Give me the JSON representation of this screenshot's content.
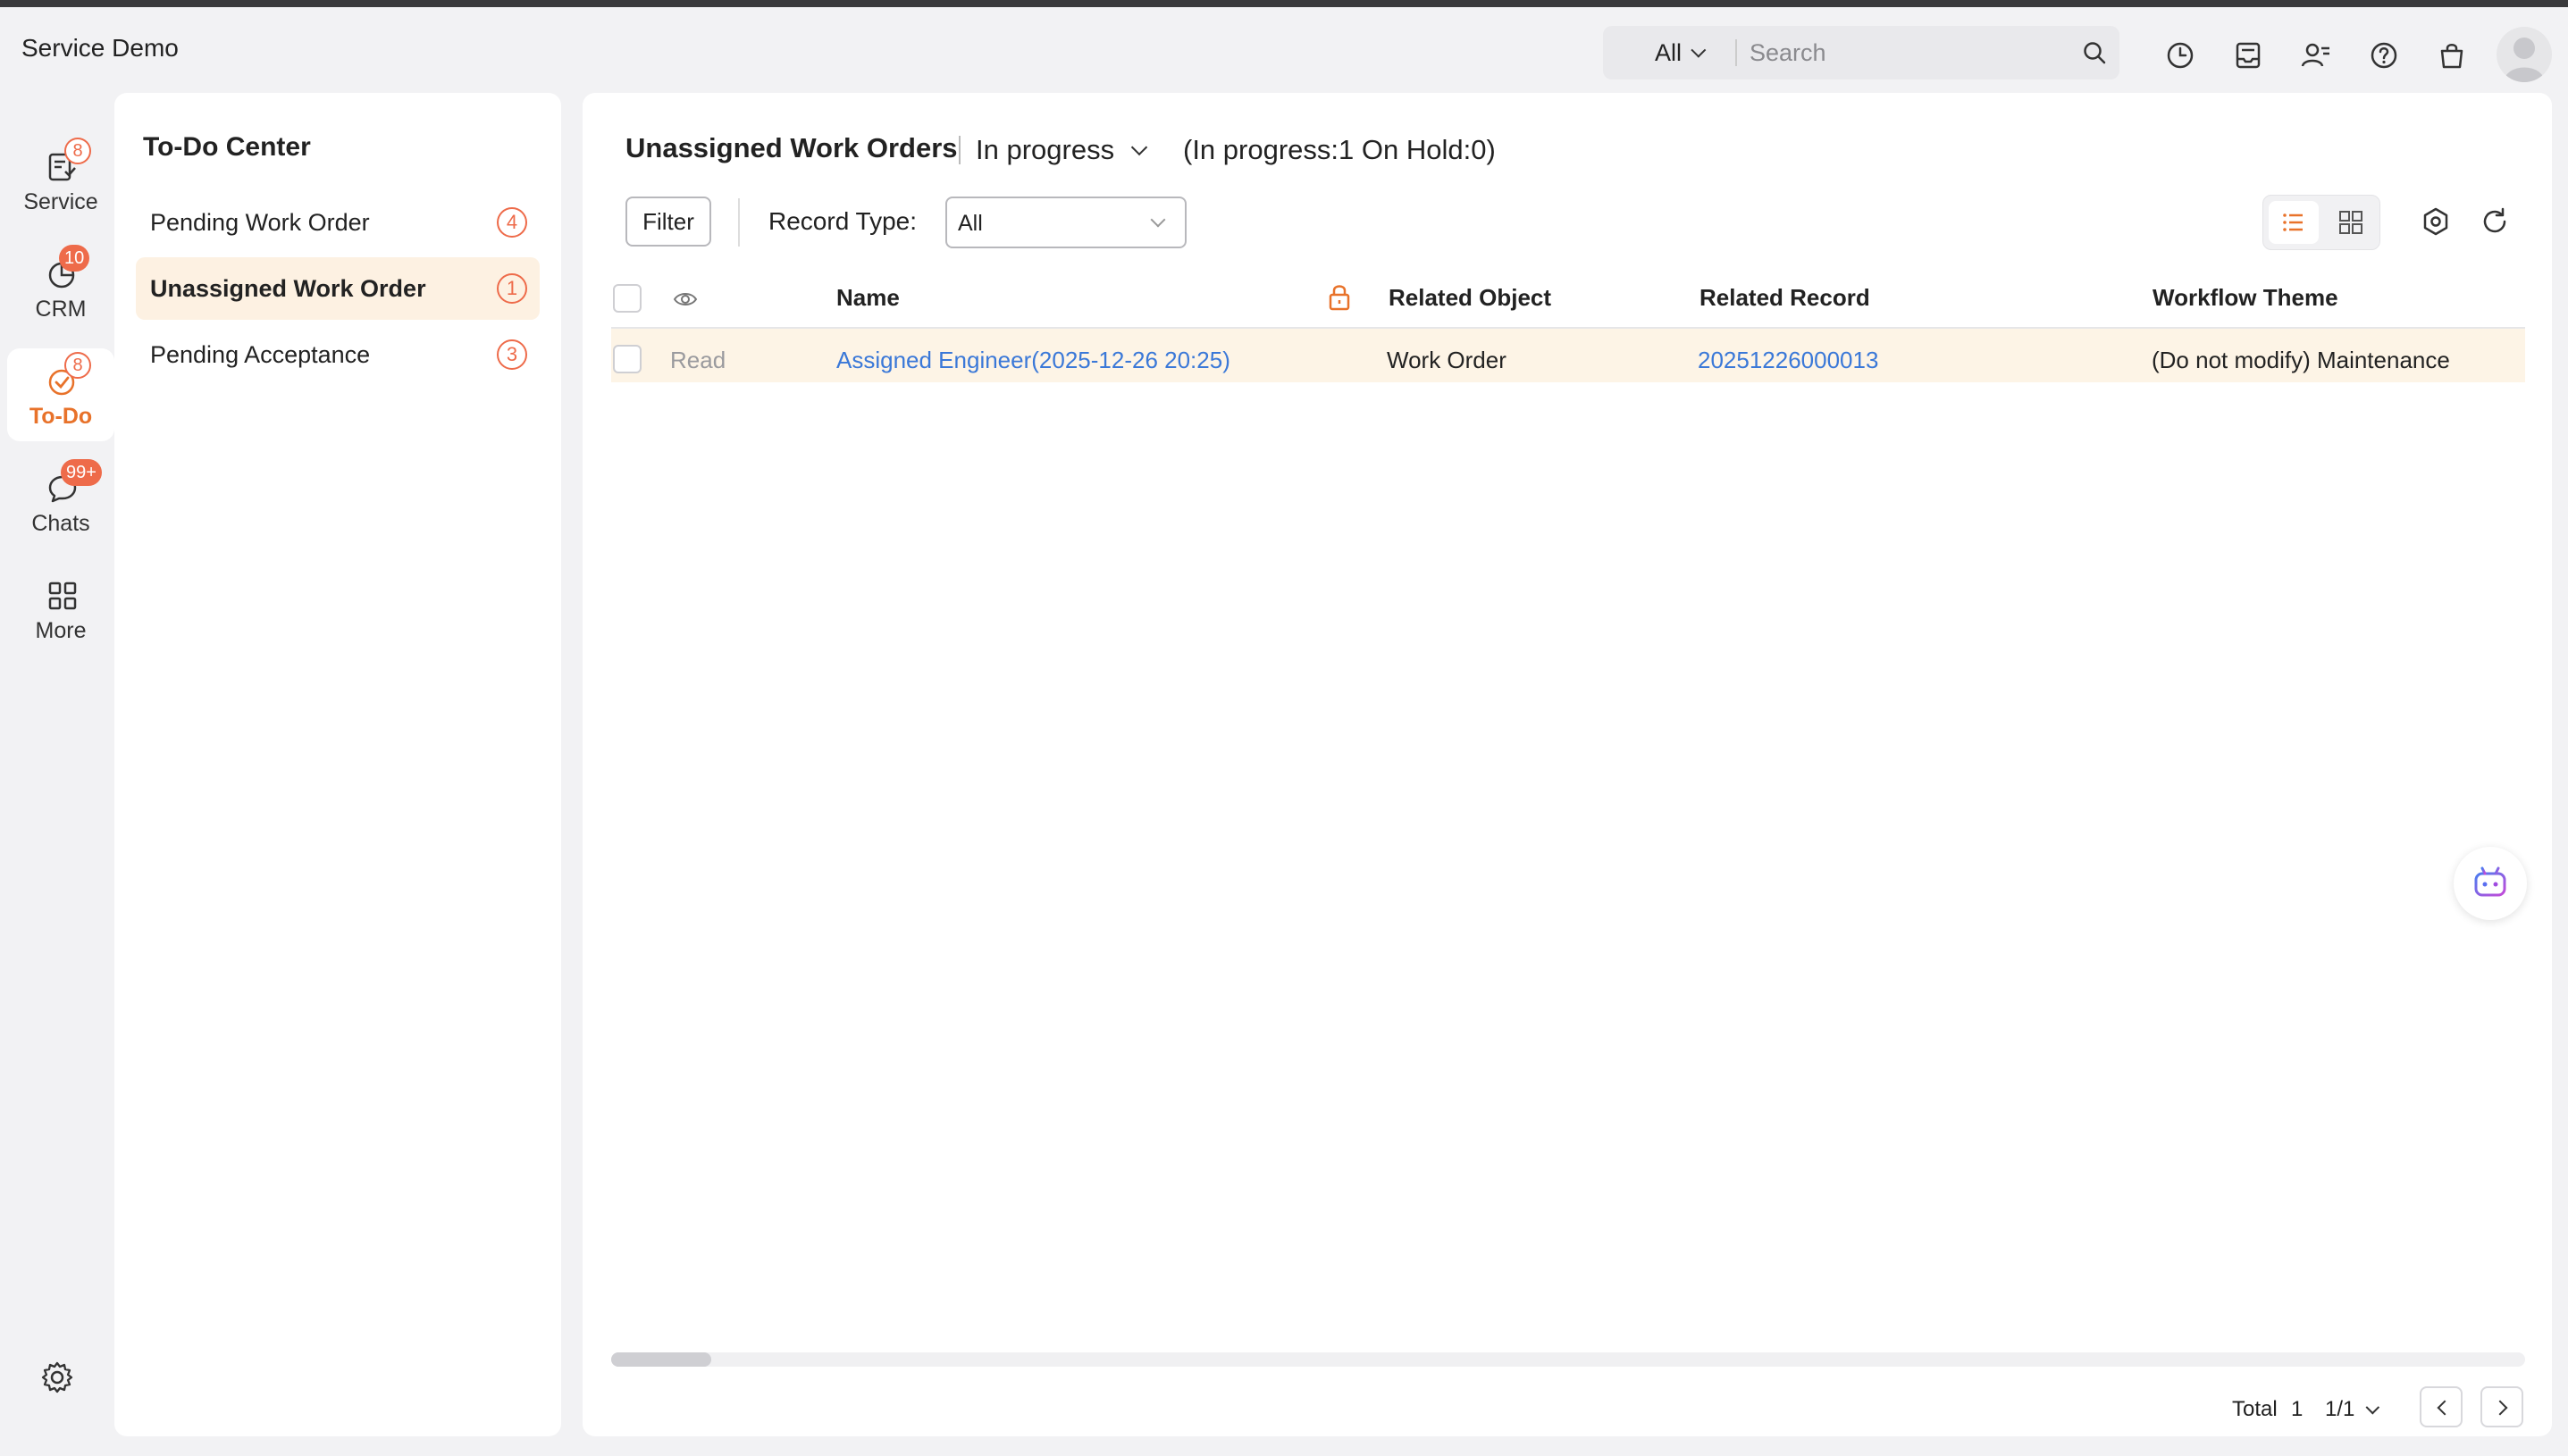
{
  "app": {
    "title": "Service Demo"
  },
  "search": {
    "scope": "All",
    "placeholder": "Search"
  },
  "header_icons": [
    "history-icon",
    "inbox-icon",
    "contacts-icon",
    "help-icon",
    "shopping-bag-icon",
    "user-avatar"
  ],
  "rail": {
    "items": [
      {
        "label": "Service",
        "badge": "8",
        "icon": "service-icon"
      },
      {
        "label": "CRM",
        "badge": "10",
        "icon": "crm-icon"
      },
      {
        "label": "To-Do",
        "badge": "8",
        "icon": "todo-icon",
        "active": true
      },
      {
        "label": "Chats",
        "badge": "99+",
        "icon": "chat-icon"
      },
      {
        "label": "More",
        "badge": "",
        "icon": "grid-icon"
      }
    ]
  },
  "todo": {
    "title": "To-Do Center",
    "items": [
      {
        "label": "Pending Work Order",
        "count": "4"
      },
      {
        "label": "Unassigned Work Order",
        "count": "1",
        "active": true
      },
      {
        "label": "Pending Acceptance",
        "count": "3"
      }
    ]
  },
  "main": {
    "title": "Unassigned Work Orders",
    "status": "In progress",
    "summary": "(In progress:1 On Hold:0)",
    "filter_label": "Filter",
    "record_type_label": "Record Type:",
    "record_type_value": "All",
    "columns": {
      "name": "Name",
      "related_object": "Related Object",
      "related_record": "Related Record",
      "workflow_theme": "Workflow Theme"
    },
    "rows": [
      {
        "read": "Read",
        "name": "Assigned Engineer(2025-12-26 20:25)",
        "related_object": "Work Order",
        "related_record": "20251226000013",
        "workflow_theme": "(Do not modify) Maintenance"
      }
    ],
    "pager": {
      "total_label": "Total",
      "total": "1",
      "page": "1/1"
    }
  },
  "colors": {
    "accent": "#e8722a",
    "badge": "#ee6b4a",
    "link": "#3a78d8",
    "selected_row": "#fdf4e6",
    "selected_nav": "#fdf1e2"
  }
}
